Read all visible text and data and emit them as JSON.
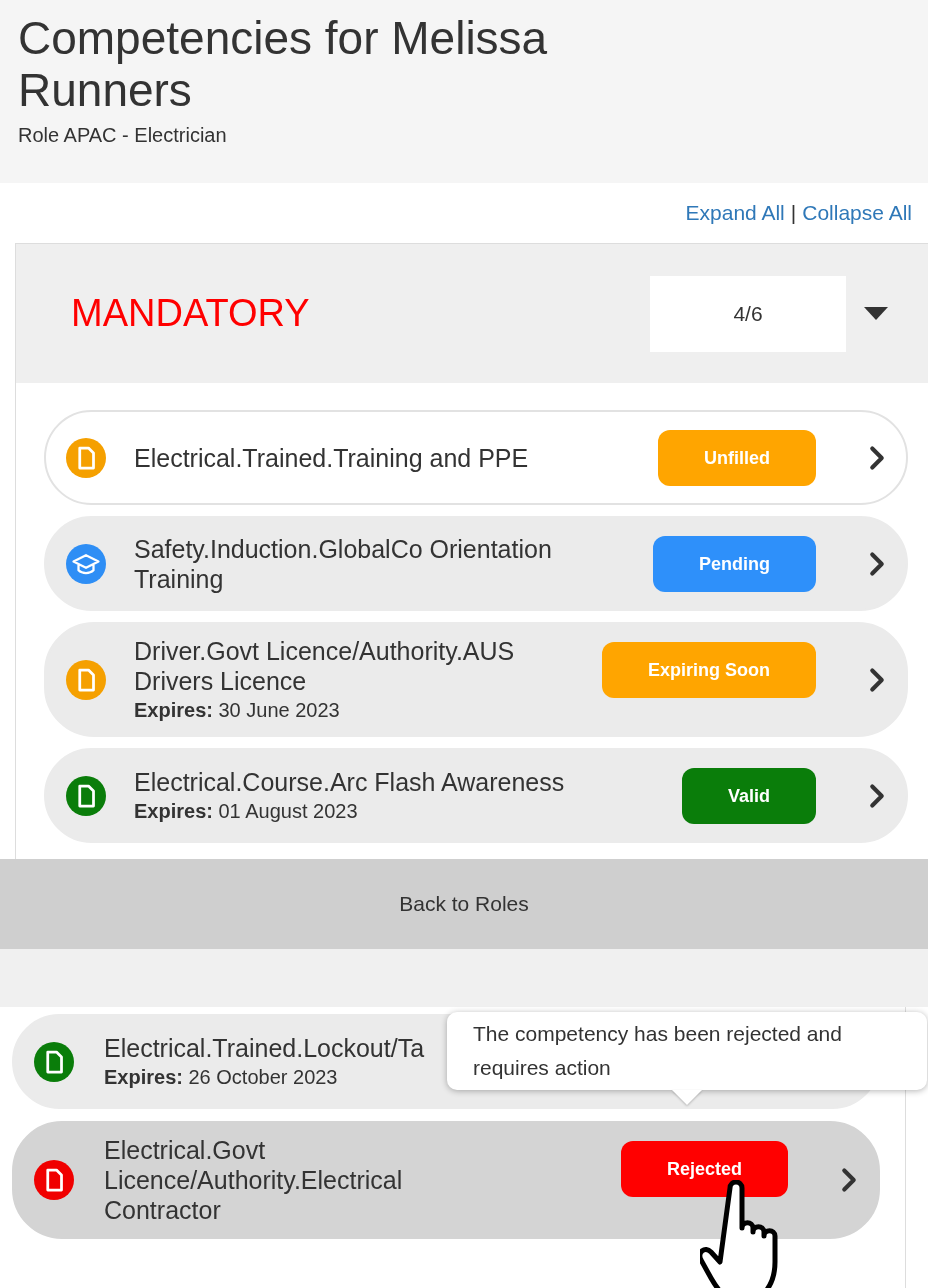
{
  "header": {
    "title": "Competencies for Melissa Runners",
    "subtitle": "Role APAC - Electrician"
  },
  "links": {
    "expand": "Expand All",
    "separator": "|",
    "collapse": "Collapse All"
  },
  "section": {
    "title": "MANDATORY",
    "count": "4/6",
    "expanded": true,
    "items": [
      {
        "kind": "document",
        "color": "#f5a000",
        "name": "Electrical.Trained.Training and PPE",
        "status": {
          "label": "Unfilled",
          "color": "#ffa500"
        },
        "outlined": true
      },
      {
        "kind": "cap",
        "color": "#2e8ef5",
        "name": "Safety.Induction.GlobalCo Orientation Training",
        "status": {
          "label": "Pending",
          "color": "#2e90fa"
        },
        "outlined": false
      },
      {
        "kind": "document",
        "color": "#f5a000",
        "name": "Driver.Govt Licence/Authority.AUS Drivers Licence",
        "expires_label": "Expires:",
        "expires": "30 June 2023",
        "status": {
          "label": "Expiring Soon",
          "color": "#ffa500"
        },
        "outlined": false
      },
      {
        "kind": "document",
        "color": "#0a7d0a",
        "name": "Electrical.Course.Arc Flash Awareness",
        "expires_label": "Expires:",
        "expires": "01 August 2023",
        "status": {
          "label": "Valid",
          "color": "#0a7d0a"
        },
        "outlined": false
      }
    ]
  },
  "back_button": "Back to Roles",
  "lower_items": [
    {
      "kind": "document",
      "color": "#0a7d0a",
      "name": "Electrical.Trained.Lockout/Ta",
      "expires_label": "Expires:",
      "expires": "26 October 2023",
      "hovered": false
    },
    {
      "kind": "document",
      "color": "#f00000",
      "name": "Electrical.Govt Licence/Authority.Electrical Contractor",
      "status": {
        "label": "Rejected",
        "color": "#ff0000"
      },
      "hovered": true
    }
  ],
  "tooltip": "The competency has been rejected and requires action"
}
